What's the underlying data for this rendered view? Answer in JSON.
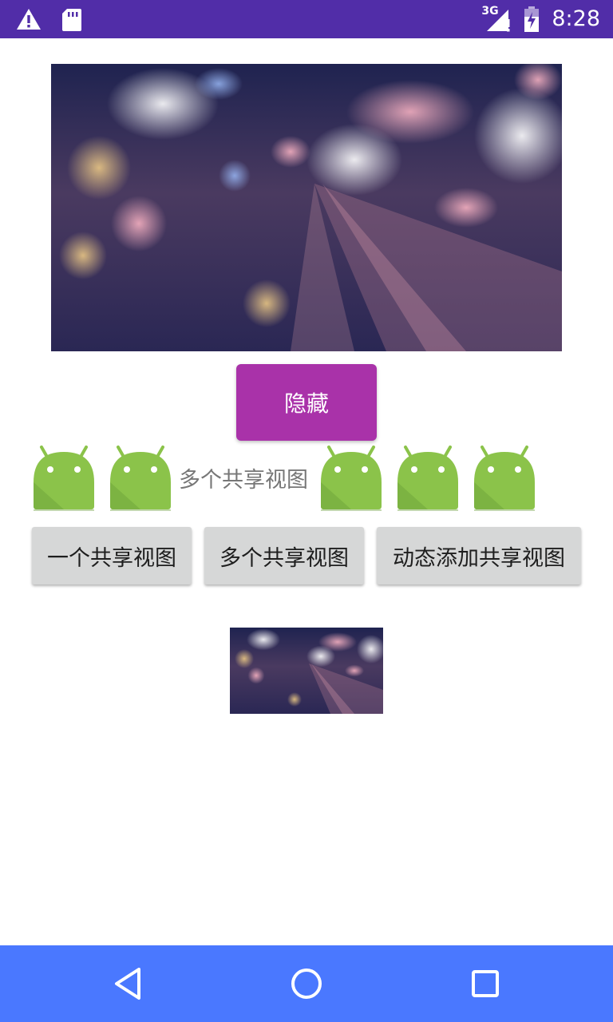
{
  "status_bar": {
    "time": "8:28",
    "network_label": "3G",
    "color": "#512da8",
    "icons": [
      "warning-icon",
      "sd-card-icon",
      "signal-3g-icon",
      "battery-icon"
    ]
  },
  "hero_image": {
    "description_icon": "blurred-city-lights-image"
  },
  "hide_button": {
    "label": "隐藏",
    "color": "#a932a9"
  },
  "android_row": {
    "label": "多个共享视图",
    "icon": "android-icon",
    "icon_color": "#8bc34a"
  },
  "buttons": [
    {
      "label": "一个共享视图"
    },
    {
      "label": "多个共享视图"
    },
    {
      "label": "动态添加共享视图"
    }
  ],
  "thumbnail": {
    "description_icon": "blurred-city-lights-thumbnail"
  },
  "nav_bar": {
    "color": "#4a78ff",
    "icons": [
      "back-icon",
      "home-icon",
      "recents-icon"
    ]
  }
}
